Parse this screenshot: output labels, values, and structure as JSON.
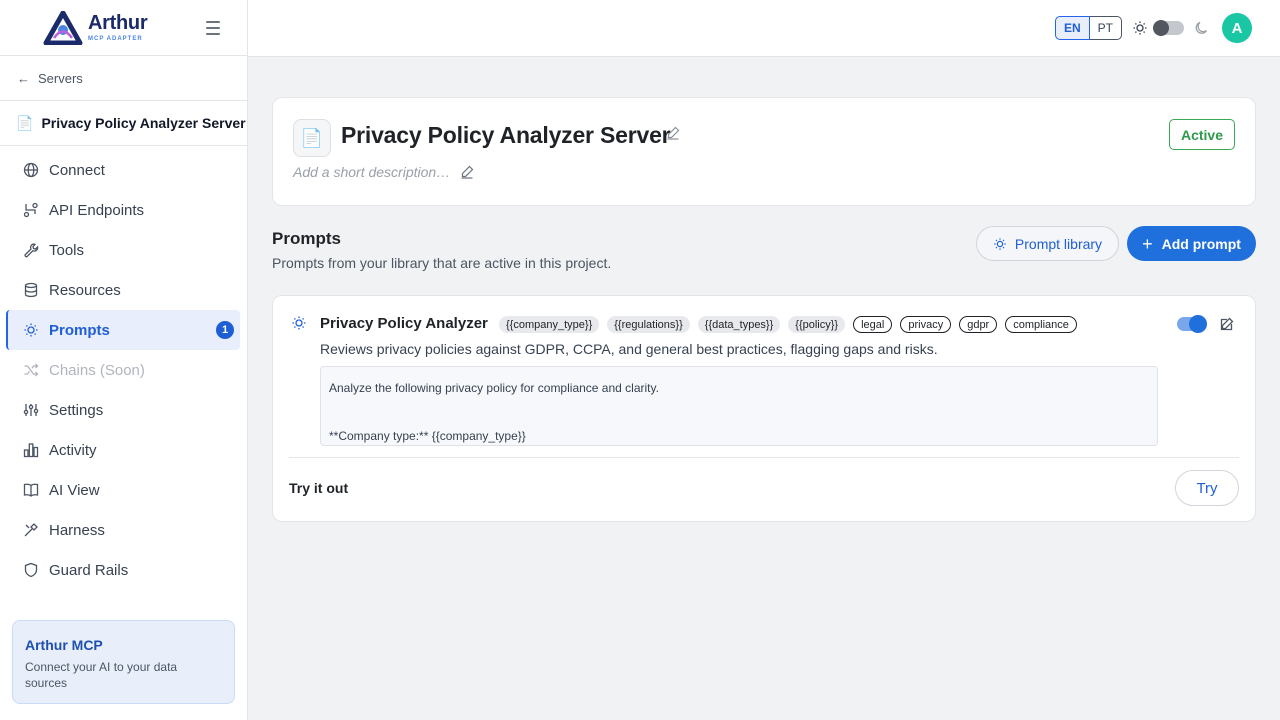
{
  "brand": {
    "name": "Arthur",
    "sub": "MCP ADAPTER"
  },
  "sidebar": {
    "back_label": "Servers",
    "server_name": "Privacy Policy Analyzer Server",
    "items": [
      {
        "label": "Connect",
        "icon": "globe-icon"
      },
      {
        "label": "API Endpoints",
        "icon": "api-endpoints-icon"
      },
      {
        "label": "Tools",
        "icon": "wrench-icon"
      },
      {
        "label": "Resources",
        "icon": "database-icon"
      },
      {
        "label": "Prompts",
        "icon": "lightbulb-icon",
        "badge": "1",
        "active": true
      },
      {
        "label": "Chains (Soon)",
        "icon": "shuffle-icon",
        "disabled": true
      },
      {
        "label": "Settings",
        "icon": "sliders-icon"
      },
      {
        "label": "Activity",
        "icon": "bar-chart-icon"
      },
      {
        "label": "AI View",
        "icon": "book-icon"
      },
      {
        "label": "Harness",
        "icon": "tools-icon"
      },
      {
        "label": "Guard Rails",
        "icon": "shield-icon"
      }
    ],
    "promo": {
      "title": "Arthur MCP",
      "text": "Connect your AI to your data sources"
    }
  },
  "topbar": {
    "languages": [
      "EN",
      "PT"
    ],
    "avatar_initial": "A"
  },
  "header": {
    "icon": "📄",
    "title": "Privacy Policy Analyzer Server",
    "description_placeholder": "Add a short description…",
    "status": "Active"
  },
  "prompts_section": {
    "title": "Prompts",
    "subtitle": "Prompts from your library that are active in this project.",
    "library_button": "Prompt library",
    "add_button": "Add prompt"
  },
  "prompt": {
    "name": "Privacy Policy Analyzer",
    "variables": [
      "{{company_type}}",
      "{{regulations}}",
      "{{data_types}}",
      "{{policy}}"
    ],
    "tags": [
      "legal",
      "privacy",
      "gdpr",
      "compliance"
    ],
    "enabled": true,
    "description": "Reviews privacy policies against GDPR, CCPA, and general best practices, flagging gaps and risks.",
    "body_lines": [
      "Analyze the following privacy policy for compliance and clarity.",
      "**Company type:** {{company_type}}"
    ],
    "try_label": "Try it out",
    "try_button": "Try"
  },
  "colors": {
    "accent": "#1f6fdc",
    "active_status": "#2e9a4c",
    "avatar": "#19c7a5"
  }
}
